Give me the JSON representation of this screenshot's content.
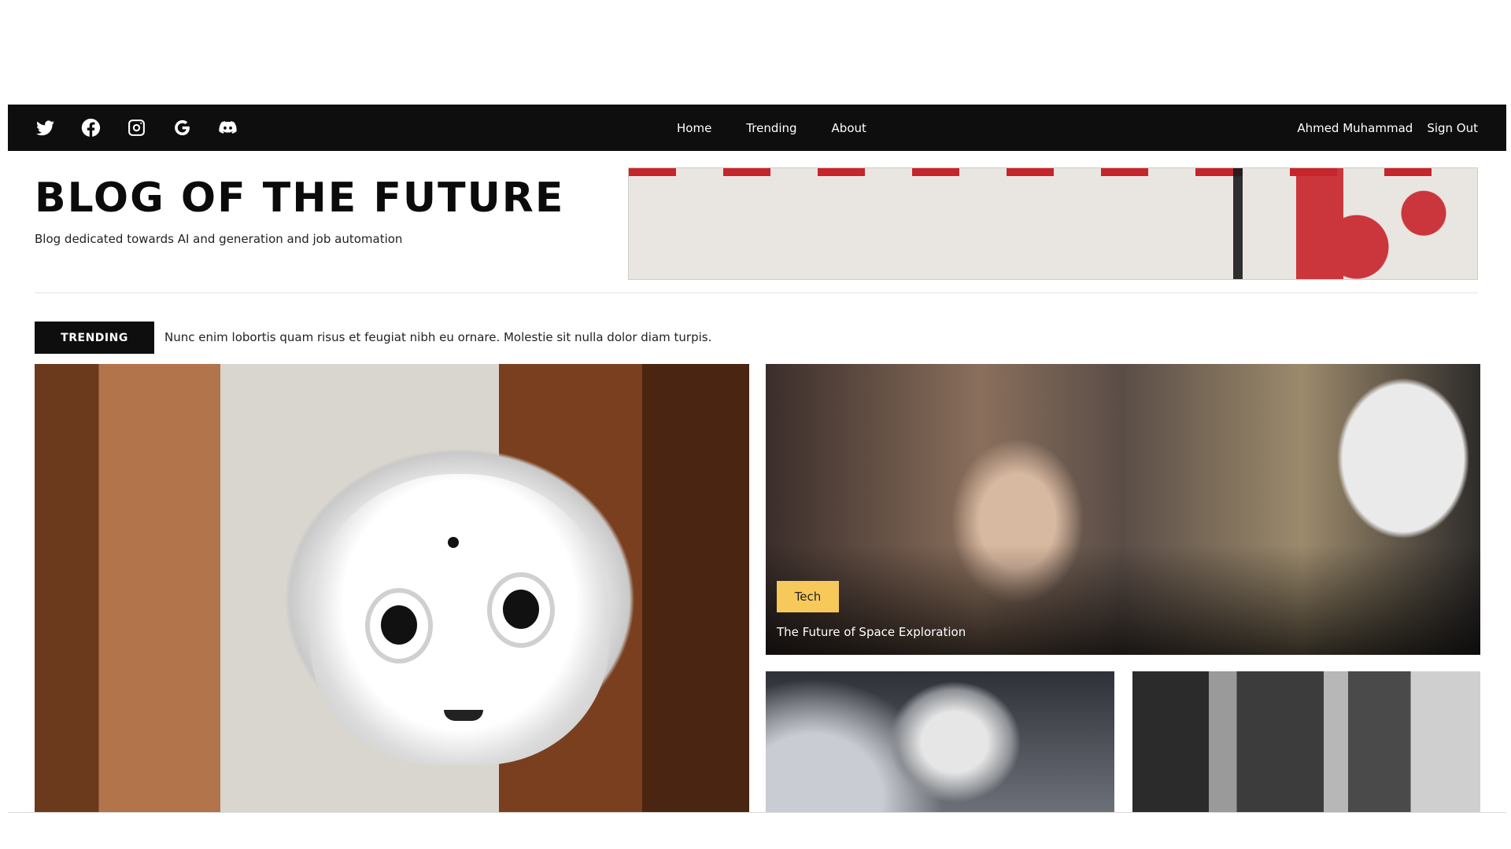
{
  "nav": {
    "social_icons": [
      "twitter-icon",
      "facebook-icon",
      "instagram-icon",
      "google-icon",
      "discord-icon"
    ],
    "links": [
      "Home",
      "Trending",
      "About"
    ],
    "user_name": "Ahmed Muhammad",
    "sign_out": "Sign Out"
  },
  "header": {
    "title": "BLOG OF THE FUTURE",
    "tagline": "Blog dedicated towards AI and generation and job automation"
  },
  "trending": {
    "badge": "TRENDING",
    "headline": "Nunc enim lobortis quam risus et feugiat nibh eu ornare. Molestie sit nulla dolor diam turpis."
  },
  "feature": {
    "tag": "Tech",
    "title": "The Future of Space Exploration"
  },
  "colors": {
    "navbar": "#0e0e0f",
    "tag": "#f6c95a",
    "banner_red": "#c7242b"
  }
}
